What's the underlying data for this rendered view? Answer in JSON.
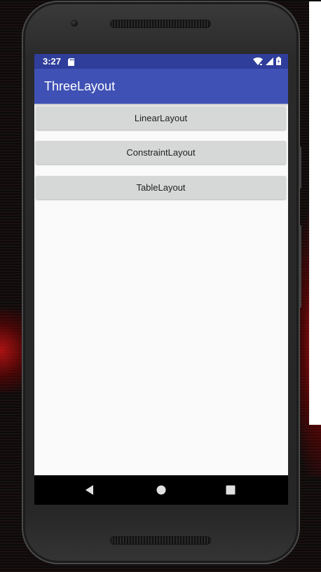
{
  "status_bar": {
    "time": "3:27",
    "icons": [
      "sd-card-icon",
      "wifi-icon",
      "signal-icon",
      "battery-icon"
    ]
  },
  "app_bar": {
    "title": "ThreeLayout"
  },
  "main": {
    "buttons": [
      {
        "label": "LinearLayout"
      },
      {
        "label": "ConstraintLayout"
      },
      {
        "label": "TableLayout"
      }
    ]
  },
  "nav_bar": {
    "icons": [
      "back-icon",
      "home-icon",
      "recents-icon"
    ]
  },
  "colors": {
    "status_bar": "#2f3d9b",
    "app_bar": "#3f51b5",
    "button_bg": "#d6d7d7",
    "screen_bg": "#fafafa"
  }
}
